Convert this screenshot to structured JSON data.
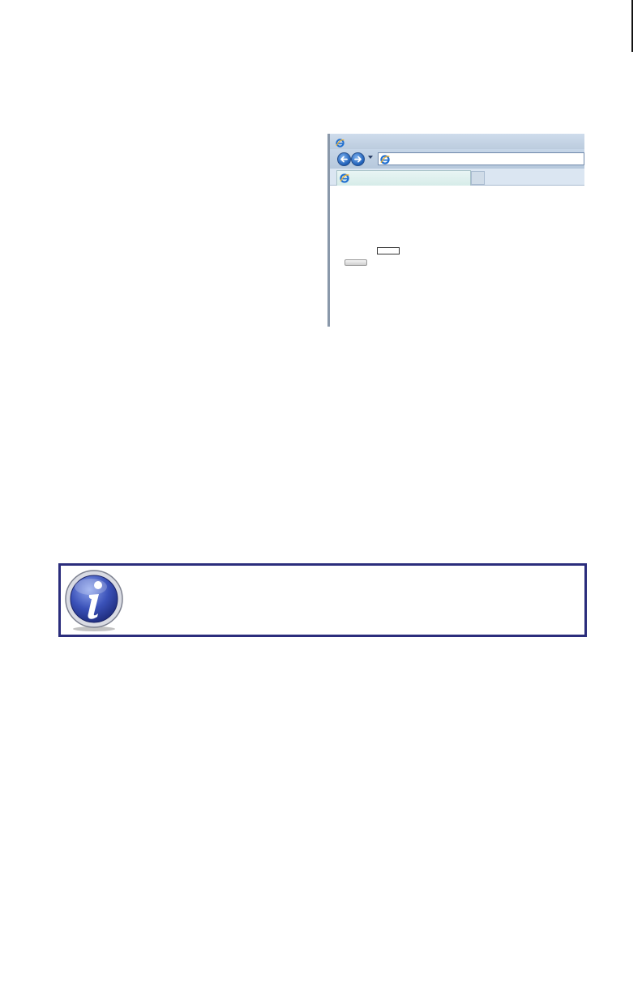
{
  "page": {
    "accent_color": "#2b2d7c"
  },
  "browser_screenshot": {
    "title_icon": "ie-logo-icon",
    "nav": {
      "back_icon": "back-arrow-icon",
      "forward_icon": "forward-arrow-icon",
      "dropdown_icon": "chevron-down-icon",
      "address_value": "",
      "address_icon": "ie-logo-icon"
    },
    "tab": {
      "label": "",
      "icon": "ie-logo-icon"
    },
    "form": {
      "field_value": "",
      "button_label": ""
    }
  },
  "note": {
    "icon": "info-icon",
    "text": ""
  }
}
